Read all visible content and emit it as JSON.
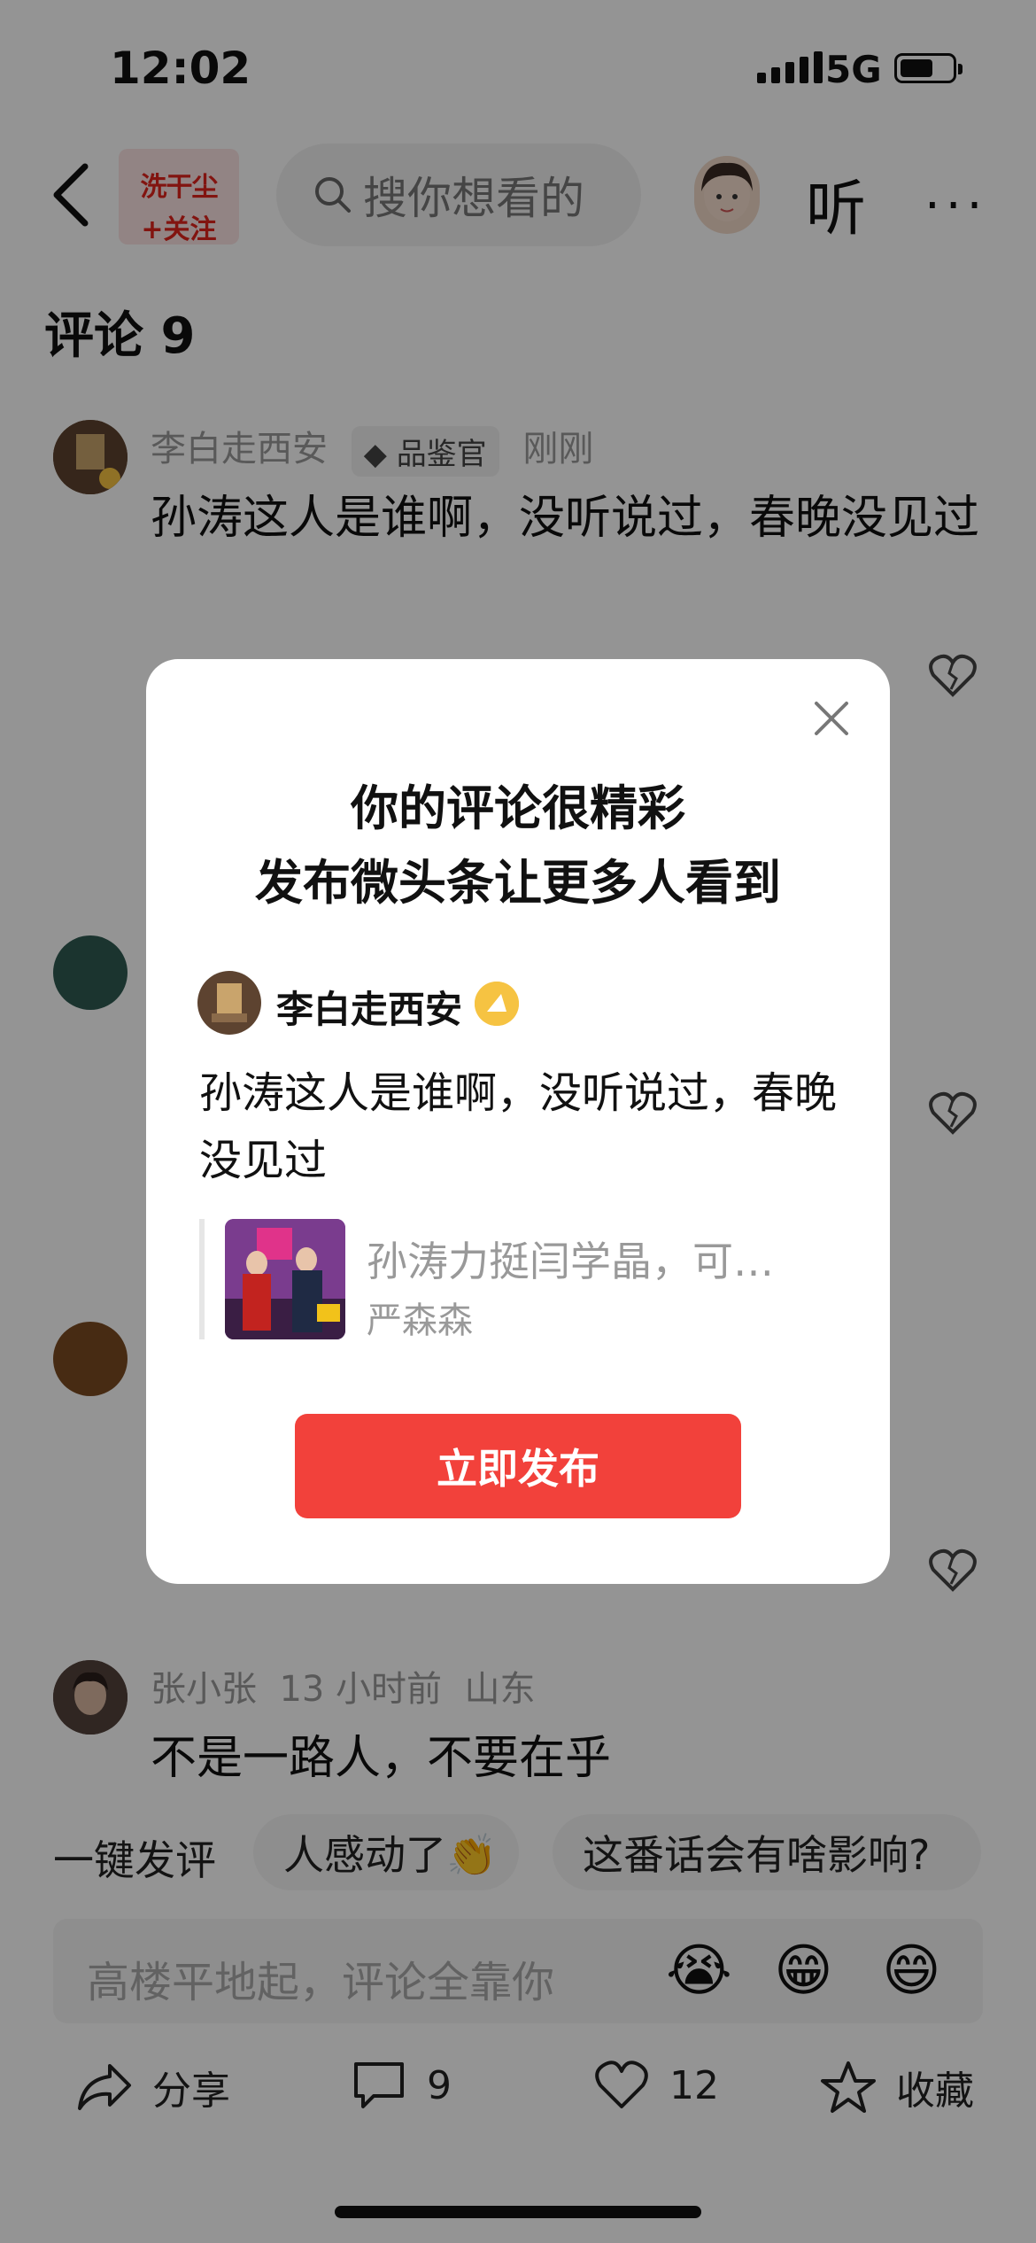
{
  "status_bar": {
    "time": "12:02",
    "network": "5G"
  },
  "header": {
    "brand_name": "洗干尘",
    "follow_label": "+关注",
    "search_placeholder": "搜你想看的",
    "listen_label": "听",
    "more_label": "···"
  },
  "comments": {
    "title": "评论 9",
    "items": [
      {
        "author": "李白走西安",
        "badge": "品鉴官",
        "time": "刚刚",
        "text": "孙涛这人是谁啊，没听说过，春晚没见过"
      },
      {
        "author": "张小张",
        "time": "13 小时前",
        "location": "山东",
        "text": "不是一路人，不要在乎"
      }
    ]
  },
  "quick_replies": {
    "lead": "一键发评",
    "items": [
      "人感动了👏",
      "这番话会有啥影响?"
    ]
  },
  "input": {
    "placeholder": "高楼平地起，评论全靠你",
    "emojis": [
      "😭",
      "😁",
      "😄"
    ]
  },
  "bottom_bar": {
    "share_label": "分享",
    "comment_count": "9",
    "like_count": "12",
    "favorite_label": "收藏"
  },
  "modal": {
    "title_line1": "你的评论很精彩",
    "title_line2": "发布微头条让更多人看到",
    "author": "李白走西安",
    "comment_text": "孙涛这人是谁啊，没听说过，春晚没见过",
    "quote_title": "孙涛力挺闫学晶，可…",
    "quote_author": "严森森",
    "publish_label": "立即发布"
  },
  "colors": {
    "accent": "#f2413b",
    "badge_gold": "#f6c342",
    "brand_red": "#e0241c"
  }
}
